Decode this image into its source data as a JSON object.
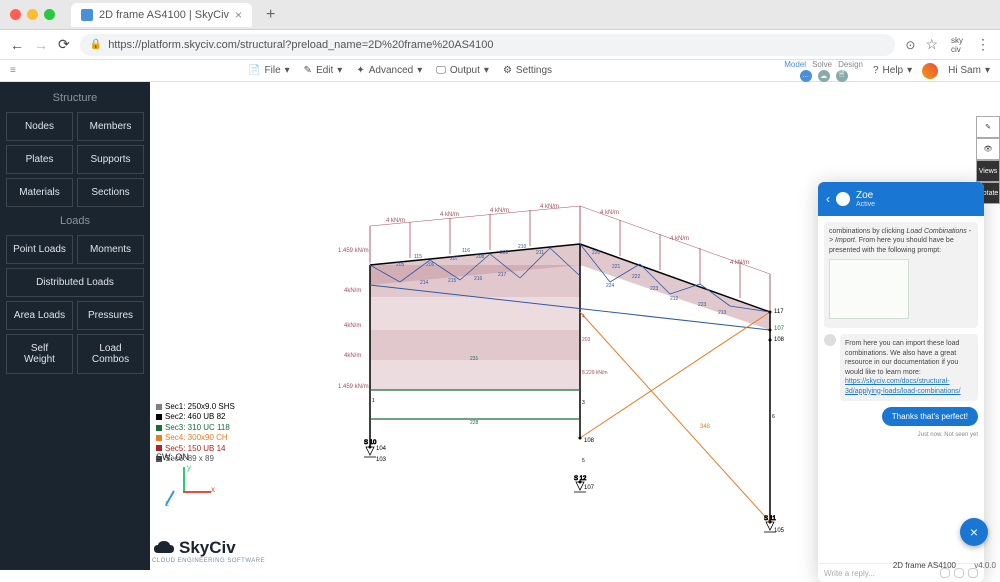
{
  "tab": {
    "title": "2D frame AS4100 | SkyCiv",
    "url_display": "https://platform.skyciv.com/structural?preload_name=2D%20frame%20AS4100"
  },
  "toolbar": {
    "file": "File",
    "edit": "Edit",
    "advanced": "Advanced",
    "output": "Output",
    "settings": "Settings",
    "help": "Help",
    "user": "Hi Sam",
    "modes": {
      "model": "Model",
      "solve": "Solve",
      "design": "Design"
    }
  },
  "sidebar": {
    "structure_head": "Structure",
    "loads_head": "Loads",
    "btns": {
      "nodes": "Nodes",
      "members": "Members",
      "plates": "Plates",
      "supports": "Supports",
      "materials": "Materials",
      "sections": "Sections",
      "point_loads": "Point Loads",
      "moments": "Moments",
      "distributed": "Distributed Loads",
      "area_loads": "Area Loads",
      "pressures": "Pressures",
      "self_weight": "Self\nWeight",
      "load_combos": "Load\nCombos"
    }
  },
  "legend": {
    "sec1": "Sec1: 250x9.0 SHS",
    "sec2": "Sec2: 460 UB 82",
    "sec3": "Sec3: 310 UC 118",
    "sec4": "Sec4: 300x90 CH",
    "sec5": "Sec5: 150 UB 14",
    "sec6": "Sec6: 89 x 89",
    "sw": "SW: ON"
  },
  "canvas_labels": {
    "dist_load_top": "4 kN/m",
    "n115": "115",
    "n116": "116",
    "n117": "117",
    "n107": "107",
    "n108": "108",
    "n104": "104",
    "n103": "103",
    "n105": "105",
    "s10": "S 10",
    "s11": "S 11",
    "s12": "S 12",
    "val1459": "1.459 kN/m",
    "val4kn": "4kN/m",
    "val4kn2": "4kN/m",
    "val4kn3": "4kN/m",
    "val1459b": "1.459 kN/m",
    "e205": "205",
    "e206": "206",
    "e207": "207",
    "e208": "208",
    "e209": "209",
    "e210": "210",
    "e211": "211",
    "e212": "212",
    "e213": "213",
    "e214": "214",
    "e215": "215",
    "e216": "216",
    "e217": "217",
    "e220": "220",
    "e221": "221",
    "e222": "222",
    "e223": "223",
    "e224": "224",
    "e231": "231",
    "e223x": "223",
    "e4": "4",
    "e228": "228",
    "e203": "203",
    "e348": "348",
    "e3": "3",
    "e5": "5",
    "e8_229": "8.229 kN/m",
    "e1": "1",
    "e6": "6"
  },
  "vtool": {
    "pen": "✎",
    "eye": "👁",
    "views": "Views",
    "rotate": "Rotate"
  },
  "chat": {
    "name": "Zoe",
    "status": "Active",
    "msg1_a": "combinations by clicking ",
    "msg1_b": "Load Combinations -> Import",
    "msg1_c": ". From here you should have be presented with the following prompt:",
    "msg2": "From here you can import these load combinations. We also have a great resource in our documentation if you would like to learn more:",
    "link": "https://skyciv.com/docs/structural-3d/applying-loads/load-combinations/",
    "reply": "Thanks that's perfect!",
    "meta": "Just now. Not seen yet",
    "placeholder": "Write a reply..."
  },
  "footer": {
    "version": "v4.0.0",
    "file": "2D frame AS4100"
  },
  "logo": {
    "name": "SkyCiv",
    "sub": "CLOUD ENGINEERING SOFTWARE"
  },
  "axes": {
    "x": "x",
    "y": "y",
    "z": "z"
  }
}
